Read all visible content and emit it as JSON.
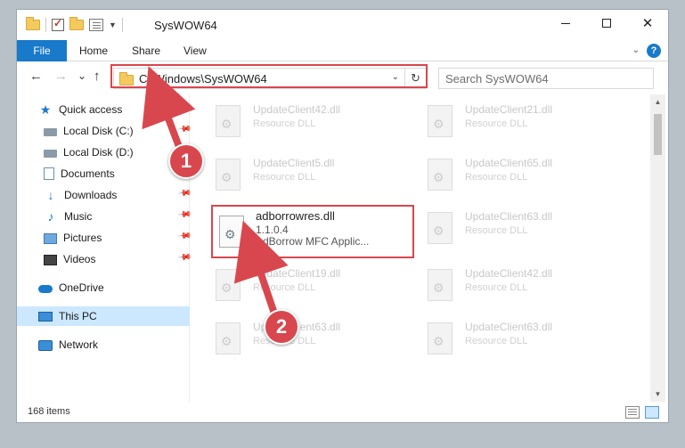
{
  "window": {
    "title": "SysWOW64",
    "controls": {
      "minimize": "minimize",
      "maximize": "maximize",
      "close": "✕"
    }
  },
  "ribbon": {
    "tabs": [
      "File",
      "Home",
      "Share",
      "View"
    ],
    "help": "?"
  },
  "nav": {
    "back": "←",
    "forward": "→",
    "recent": "⌄",
    "up": "↑",
    "address": "C:\\Windows\\SysWOW64",
    "refresh": "↻",
    "search_placeholder": "Search SysWOW64"
  },
  "sidebar": {
    "items": [
      {
        "label": "Quick access",
        "icon": "star-icon",
        "pinned": false
      },
      {
        "label": "Local Disk (C:)",
        "icon": "disk-icon",
        "pinned": true
      },
      {
        "label": "Local Disk (D:)",
        "icon": "disk-icon",
        "pinned": false
      },
      {
        "label": "Documents",
        "icon": "documents-icon",
        "pinned": true
      },
      {
        "label": "Downloads",
        "icon": "download-icon",
        "pinned": true
      },
      {
        "label": "Music",
        "icon": "music-icon",
        "pinned": true
      },
      {
        "label": "Pictures",
        "icon": "pictures-icon",
        "pinned": true
      },
      {
        "label": "Videos",
        "icon": "videos-icon",
        "pinned": true
      },
      {
        "label": "OneDrive",
        "icon": "onedrive-icon",
        "pinned": false
      },
      {
        "label": "This PC",
        "icon": "this-pc-icon",
        "pinned": false,
        "selected": true
      },
      {
        "label": "Network",
        "icon": "network-icon",
        "pinned": false
      }
    ]
  },
  "files": {
    "left_column": [
      {
        "name": "UpdateClient42.dll",
        "type": "Resource DLL"
      },
      {
        "name": "UpdateClient5.dll",
        "type": "Resource DLL"
      },
      {
        "name": "adborrowres.dll",
        "version": "1.1.0.4",
        "description": "AdBorrow MFC Applic...",
        "selected": true
      },
      {
        "name": "UpdateClient19.dll",
        "type": "Resource DLL"
      },
      {
        "name": "UpdateClient63.dll",
        "type": "Resource DLL"
      }
    ],
    "right_column": [
      {
        "name": "UpdateClient21.dll",
        "type": "Resource DLL"
      },
      {
        "name": "UpdateClient65.dll",
        "type": "Resource DLL"
      },
      {
        "name": "UpdateClient63.dll",
        "type": "Resource DLL"
      },
      {
        "name": "UpdateClient42.dll",
        "type": "Resource DLL"
      },
      {
        "name": "UpdateClient63.dll",
        "type": "Resource DLL"
      }
    ]
  },
  "status": {
    "item_count": "168 items"
  },
  "annotations": {
    "step1": "1",
    "step2": "2",
    "color": "#d9474e"
  },
  "colors": {
    "accent": "#1979ca",
    "selection": "#cce8ff",
    "annotation": "#d9474e"
  }
}
